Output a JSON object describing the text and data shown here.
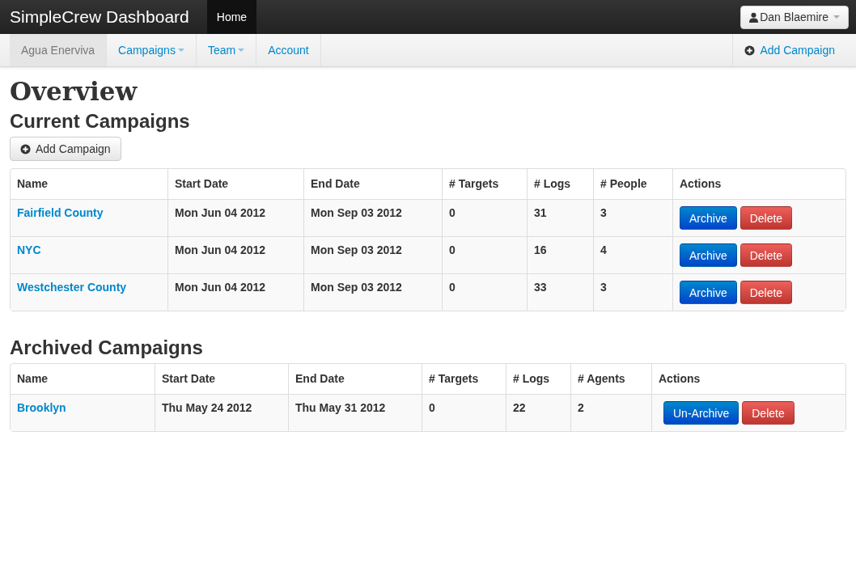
{
  "topbar": {
    "brand": "SimpleCrew Dashboard",
    "nav": [
      {
        "label": "Home",
        "selected": true
      }
    ],
    "user": "Dan Blaemire"
  },
  "subnav": {
    "items": [
      {
        "label": "Agua Enerviva",
        "selected": true,
        "dropdown": false
      },
      {
        "label": "Campaigns",
        "selected": false,
        "dropdown": true
      },
      {
        "label": "Team",
        "selected": false,
        "dropdown": true
      },
      {
        "label": "Account",
        "selected": false,
        "dropdown": false
      }
    ],
    "action": "Add Campaign"
  },
  "page_title": "Overview",
  "sections": [
    {
      "title": "Current Campaigns",
      "button": "Add Campaign",
      "table": {
        "columns": [
          "Name",
          "Start Date",
          "End Date",
          "# Targets",
          "# Logs",
          "# People",
          "Actions"
        ],
        "rows": [
          {
            "cells": [
              "Fairfield County",
              "Mon Jun 04 2012",
              "Mon Sep 03 2012",
              "0",
              "31",
              "3"
            ],
            "actions": [
              {
                "label": "Archive",
                "kind": "primary"
              },
              {
                "label": "Delete",
                "kind": "danger"
              }
            ]
          },
          {
            "cells": [
              "NYC",
              "Mon Jun 04 2012",
              "Mon Sep 03 2012",
              "0",
              "16",
              "4"
            ],
            "actions": [
              {
                "label": "Archive",
                "kind": "primary"
              },
              {
                "label": "Delete",
                "kind": "danger"
              }
            ]
          },
          {
            "cells": [
              "Westchester County",
              "Mon Jun 04 2012",
              "Mon Sep 03 2012",
              "0",
              "33",
              "3"
            ],
            "actions": [
              {
                "label": "Archive",
                "kind": "primary"
              },
              {
                "label": "Delete",
                "kind": "danger"
              }
            ]
          }
        ]
      }
    },
    {
      "title": "Archived Campaigns",
      "table": {
        "columns": [
          "Name",
          "Start Date",
          "End Date",
          "# Targets",
          "# Logs",
          "# Agents",
          "Actions"
        ],
        "rows": [
          {
            "cells": [
              "Brooklyn",
              "Thu May 24 2012",
              "Thu May 31 2012",
              "0",
              "22",
              "2"
            ],
            "actions": [
              {
                "label": "Un-Archive",
                "kind": "primary"
              },
              {
                "label": "Delete",
                "kind": "danger"
              }
            ]
          }
        ]
      }
    }
  ]
}
